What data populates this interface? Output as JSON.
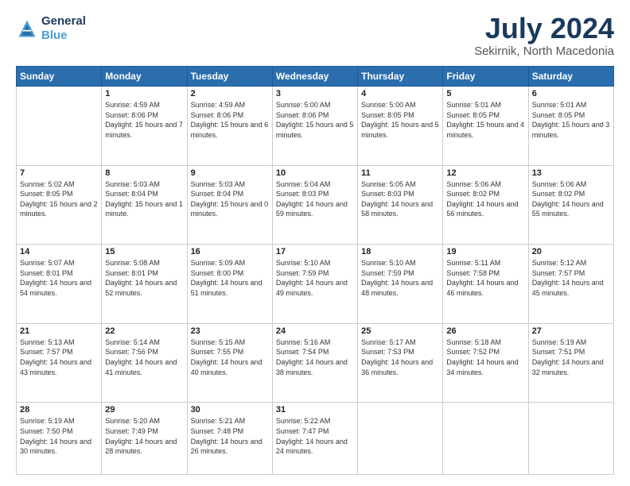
{
  "header": {
    "logo_line1": "General",
    "logo_line2": "Blue",
    "month": "July 2024",
    "location": "Sekirnik, North Macedonia"
  },
  "weekdays": [
    "Sunday",
    "Monday",
    "Tuesday",
    "Wednesday",
    "Thursday",
    "Friday",
    "Saturday"
  ],
  "weeks": [
    [
      {
        "day": "",
        "info": ""
      },
      {
        "day": "1",
        "info": "Sunrise: 4:59 AM\nSunset: 8:06 PM\nDaylight: 15 hours\nand 7 minutes."
      },
      {
        "day": "2",
        "info": "Sunrise: 4:59 AM\nSunset: 8:06 PM\nDaylight: 15 hours\nand 6 minutes."
      },
      {
        "day": "3",
        "info": "Sunrise: 5:00 AM\nSunset: 8:06 PM\nDaylight: 15 hours\nand 5 minutes."
      },
      {
        "day": "4",
        "info": "Sunrise: 5:00 AM\nSunset: 8:05 PM\nDaylight: 15 hours\nand 5 minutes."
      },
      {
        "day": "5",
        "info": "Sunrise: 5:01 AM\nSunset: 8:05 PM\nDaylight: 15 hours\nand 4 minutes."
      },
      {
        "day": "6",
        "info": "Sunrise: 5:01 AM\nSunset: 8:05 PM\nDaylight: 15 hours\nand 3 minutes."
      }
    ],
    [
      {
        "day": "7",
        "info": "Sunrise: 5:02 AM\nSunset: 8:05 PM\nDaylight: 15 hours\nand 2 minutes."
      },
      {
        "day": "8",
        "info": "Sunrise: 5:03 AM\nSunset: 8:04 PM\nDaylight: 15 hours\nand 1 minute."
      },
      {
        "day": "9",
        "info": "Sunrise: 5:03 AM\nSunset: 8:04 PM\nDaylight: 15 hours\nand 0 minutes."
      },
      {
        "day": "10",
        "info": "Sunrise: 5:04 AM\nSunset: 8:03 PM\nDaylight: 14 hours\nand 59 minutes."
      },
      {
        "day": "11",
        "info": "Sunrise: 5:05 AM\nSunset: 8:03 PM\nDaylight: 14 hours\nand 58 minutes."
      },
      {
        "day": "12",
        "info": "Sunrise: 5:06 AM\nSunset: 8:02 PM\nDaylight: 14 hours\nand 56 minutes."
      },
      {
        "day": "13",
        "info": "Sunrise: 5:06 AM\nSunset: 8:02 PM\nDaylight: 14 hours\nand 55 minutes."
      }
    ],
    [
      {
        "day": "14",
        "info": "Sunrise: 5:07 AM\nSunset: 8:01 PM\nDaylight: 14 hours\nand 54 minutes."
      },
      {
        "day": "15",
        "info": "Sunrise: 5:08 AM\nSunset: 8:01 PM\nDaylight: 14 hours\nand 52 minutes."
      },
      {
        "day": "16",
        "info": "Sunrise: 5:09 AM\nSunset: 8:00 PM\nDaylight: 14 hours\nand 51 minutes."
      },
      {
        "day": "17",
        "info": "Sunrise: 5:10 AM\nSunset: 7:59 PM\nDaylight: 14 hours\nand 49 minutes."
      },
      {
        "day": "18",
        "info": "Sunrise: 5:10 AM\nSunset: 7:59 PM\nDaylight: 14 hours\nand 48 minutes."
      },
      {
        "day": "19",
        "info": "Sunrise: 5:11 AM\nSunset: 7:58 PM\nDaylight: 14 hours\nand 46 minutes."
      },
      {
        "day": "20",
        "info": "Sunrise: 5:12 AM\nSunset: 7:57 PM\nDaylight: 14 hours\nand 45 minutes."
      }
    ],
    [
      {
        "day": "21",
        "info": "Sunrise: 5:13 AM\nSunset: 7:57 PM\nDaylight: 14 hours\nand 43 minutes."
      },
      {
        "day": "22",
        "info": "Sunrise: 5:14 AM\nSunset: 7:56 PM\nDaylight: 14 hours\nand 41 minutes."
      },
      {
        "day": "23",
        "info": "Sunrise: 5:15 AM\nSunset: 7:55 PM\nDaylight: 14 hours\nand 40 minutes."
      },
      {
        "day": "24",
        "info": "Sunrise: 5:16 AM\nSunset: 7:54 PM\nDaylight: 14 hours\nand 38 minutes."
      },
      {
        "day": "25",
        "info": "Sunrise: 5:17 AM\nSunset: 7:53 PM\nDaylight: 14 hours\nand 36 minutes."
      },
      {
        "day": "26",
        "info": "Sunrise: 5:18 AM\nSunset: 7:52 PM\nDaylight: 14 hours\nand 34 minutes."
      },
      {
        "day": "27",
        "info": "Sunrise: 5:19 AM\nSunset: 7:51 PM\nDaylight: 14 hours\nand 32 minutes."
      }
    ],
    [
      {
        "day": "28",
        "info": "Sunrise: 5:19 AM\nSunset: 7:50 PM\nDaylight: 14 hours\nand 30 minutes."
      },
      {
        "day": "29",
        "info": "Sunrise: 5:20 AM\nSunset: 7:49 PM\nDaylight: 14 hours\nand 28 minutes."
      },
      {
        "day": "30",
        "info": "Sunrise: 5:21 AM\nSunset: 7:48 PM\nDaylight: 14 hours\nand 26 minutes."
      },
      {
        "day": "31",
        "info": "Sunrise: 5:22 AM\nSunset: 7:47 PM\nDaylight: 14 hours\nand 24 minutes."
      },
      {
        "day": "",
        "info": ""
      },
      {
        "day": "",
        "info": ""
      },
      {
        "day": "",
        "info": ""
      }
    ]
  ]
}
